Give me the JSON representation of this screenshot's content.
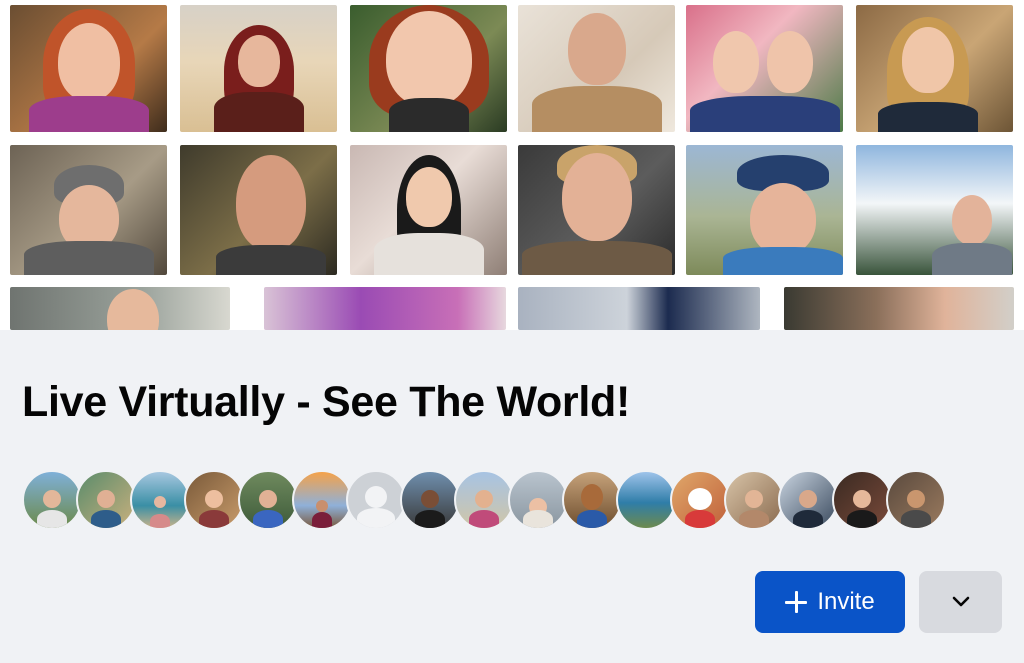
{
  "group": {
    "title": "Live Virtually - See The World!"
  },
  "cover": {
    "description_icons": "cover-photo-collage"
  },
  "members": {
    "count_shown": 17
  },
  "actions": {
    "invite_label": "Invite",
    "invite_icon": "plus-icon",
    "more_icon": "chevron-down-icon",
    "invite_color": "#0a54c8",
    "more_bg": "#d8dadf"
  },
  "colors": {
    "page_bg": "#f0f2f5",
    "title": "#050505"
  }
}
